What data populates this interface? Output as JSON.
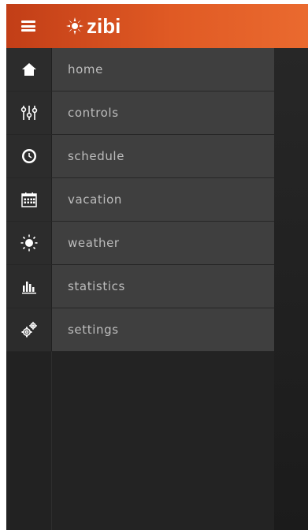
{
  "app": {
    "brand": "zibi",
    "colors": {
      "accent_start": "#c23e17",
      "accent_end": "#ea6a2f",
      "text": "#ffffff",
      "menu_text": "#bdbdbd"
    }
  },
  "header": {
    "menu_icon": "hamburger-icon",
    "logo_icon": "zibi-sun-icon"
  },
  "menu": {
    "items": [
      {
        "label": "home",
        "icon": "home-icon"
      },
      {
        "label": "controls",
        "icon": "sliders-icon"
      },
      {
        "label": "schedule",
        "icon": "clock-icon"
      },
      {
        "label": "vacation",
        "icon": "calendar-icon"
      },
      {
        "label": "weather",
        "icon": "sun-icon"
      },
      {
        "label": "statistics",
        "icon": "bar-chart-icon"
      },
      {
        "label": "settings",
        "icon": "gears-icon"
      }
    ]
  }
}
